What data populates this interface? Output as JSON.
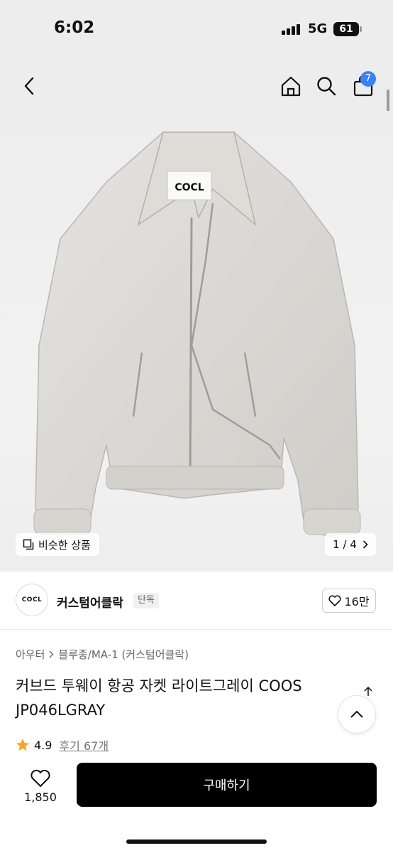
{
  "status_bar": {
    "time": "6:02",
    "network": "5G",
    "battery": "61"
  },
  "nav": {
    "cart_count": "7"
  },
  "gallery": {
    "similar_label": "비슷한 상품",
    "counter": "1 / 4",
    "logo_text": "COCL"
  },
  "brand": {
    "logo_text": "COCL",
    "name": "커스텀어클락",
    "badge": "단독",
    "likes": "16만"
  },
  "product": {
    "breadcrumb": [
      "아우터",
      "블루종/MA-1 (커스텀어클락)"
    ],
    "title": "커브드 투웨이 항공 자켓 라이트그레이 COOS JP046LGRAY",
    "rating": "4.9",
    "reviews": "후기 67개"
  },
  "bottom": {
    "wish_count": "1,850",
    "buy_label": "구매하기"
  },
  "colors": {
    "accent": "#3b82f6",
    "star": "#f5a623",
    "buy_bg": "#000000"
  }
}
